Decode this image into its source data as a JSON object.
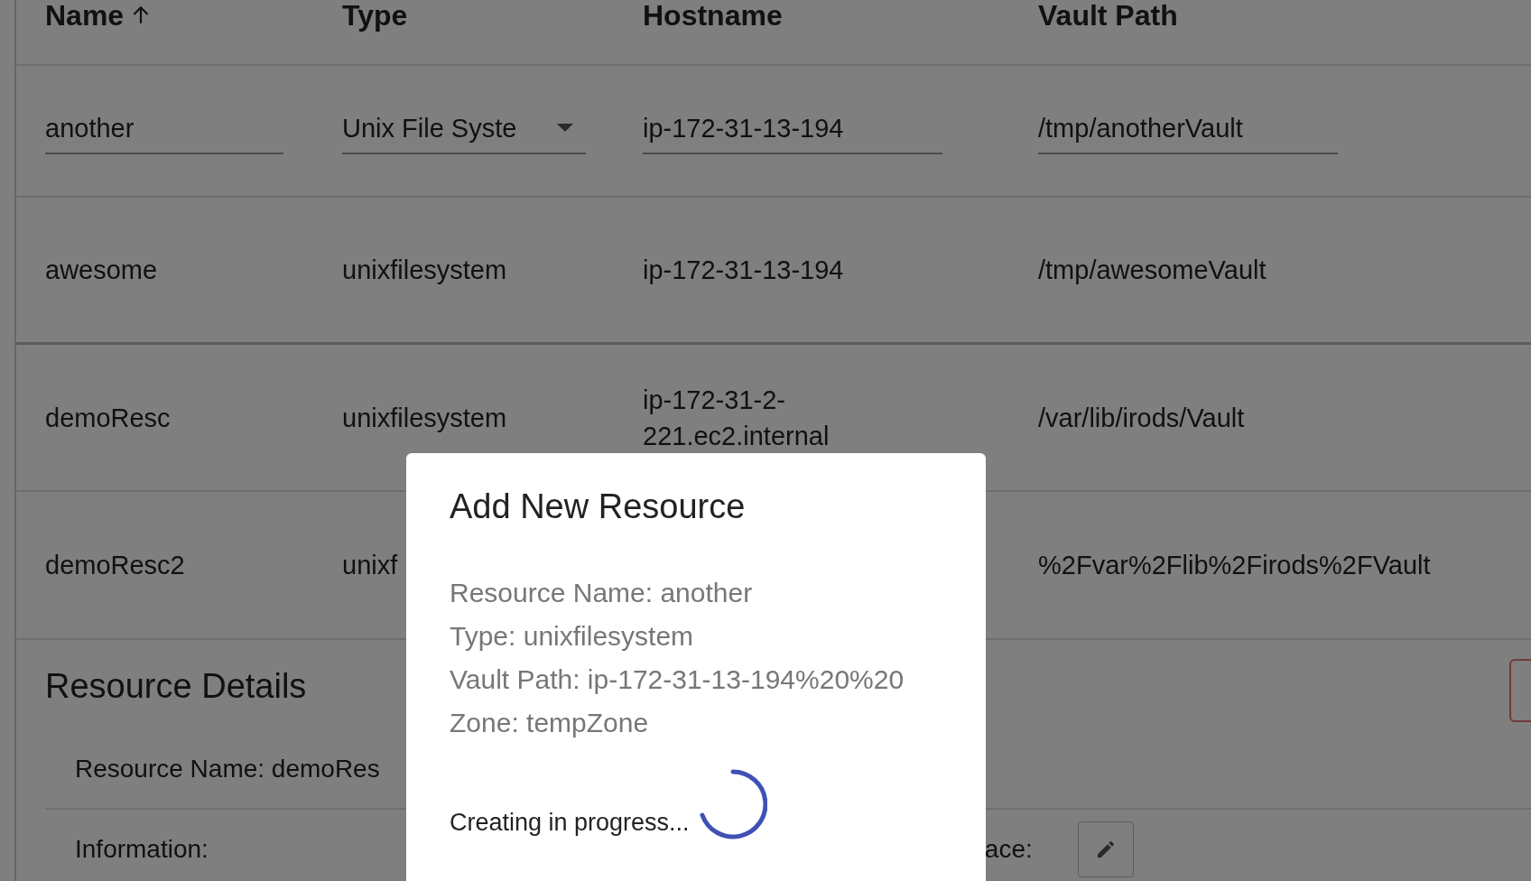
{
  "table": {
    "columns": [
      {
        "label": "Name",
        "sorted": true
      },
      {
        "label": "Type",
        "sorted": false
      },
      {
        "label": "Hostname",
        "sorted": false
      },
      {
        "label": "Vault Path",
        "sorted": false
      }
    ],
    "edit_row": {
      "name": "another",
      "type": "Unix File Syste",
      "hostname": "ip-172-31-13-194",
      "vault_path": "/tmp/anotherVault"
    },
    "rows": [
      {
        "cells": [
          "awesome",
          "unixfilesystem",
          "ip-172-31-13-194",
          "/tmp/awesomeVault"
        ]
      },
      {
        "cells": [
          "demoResc",
          "unixfilesystem",
          "ip-172-31-2-221.ec2.internal",
          "/var/lib/irods/Vault"
        ]
      },
      {
        "cells": [
          "demoResc2",
          "unixf",
          "",
          "%2Fvar%2Flib%2Firods%2FVault"
        ]
      }
    ]
  },
  "details": {
    "title": "Resource Details",
    "name_line": "Resource Name: demoRes",
    "information_label": "Information:",
    "right_label": "ace:"
  },
  "dialog": {
    "title": "Add New Resource",
    "lines": [
      "Resource Name: another",
      "Type: unixfilesystem",
      "Vault Path: ip-172-31-13-194%20%20",
      "Zone: tempZone"
    ],
    "status": "Creating in progress..."
  }
}
